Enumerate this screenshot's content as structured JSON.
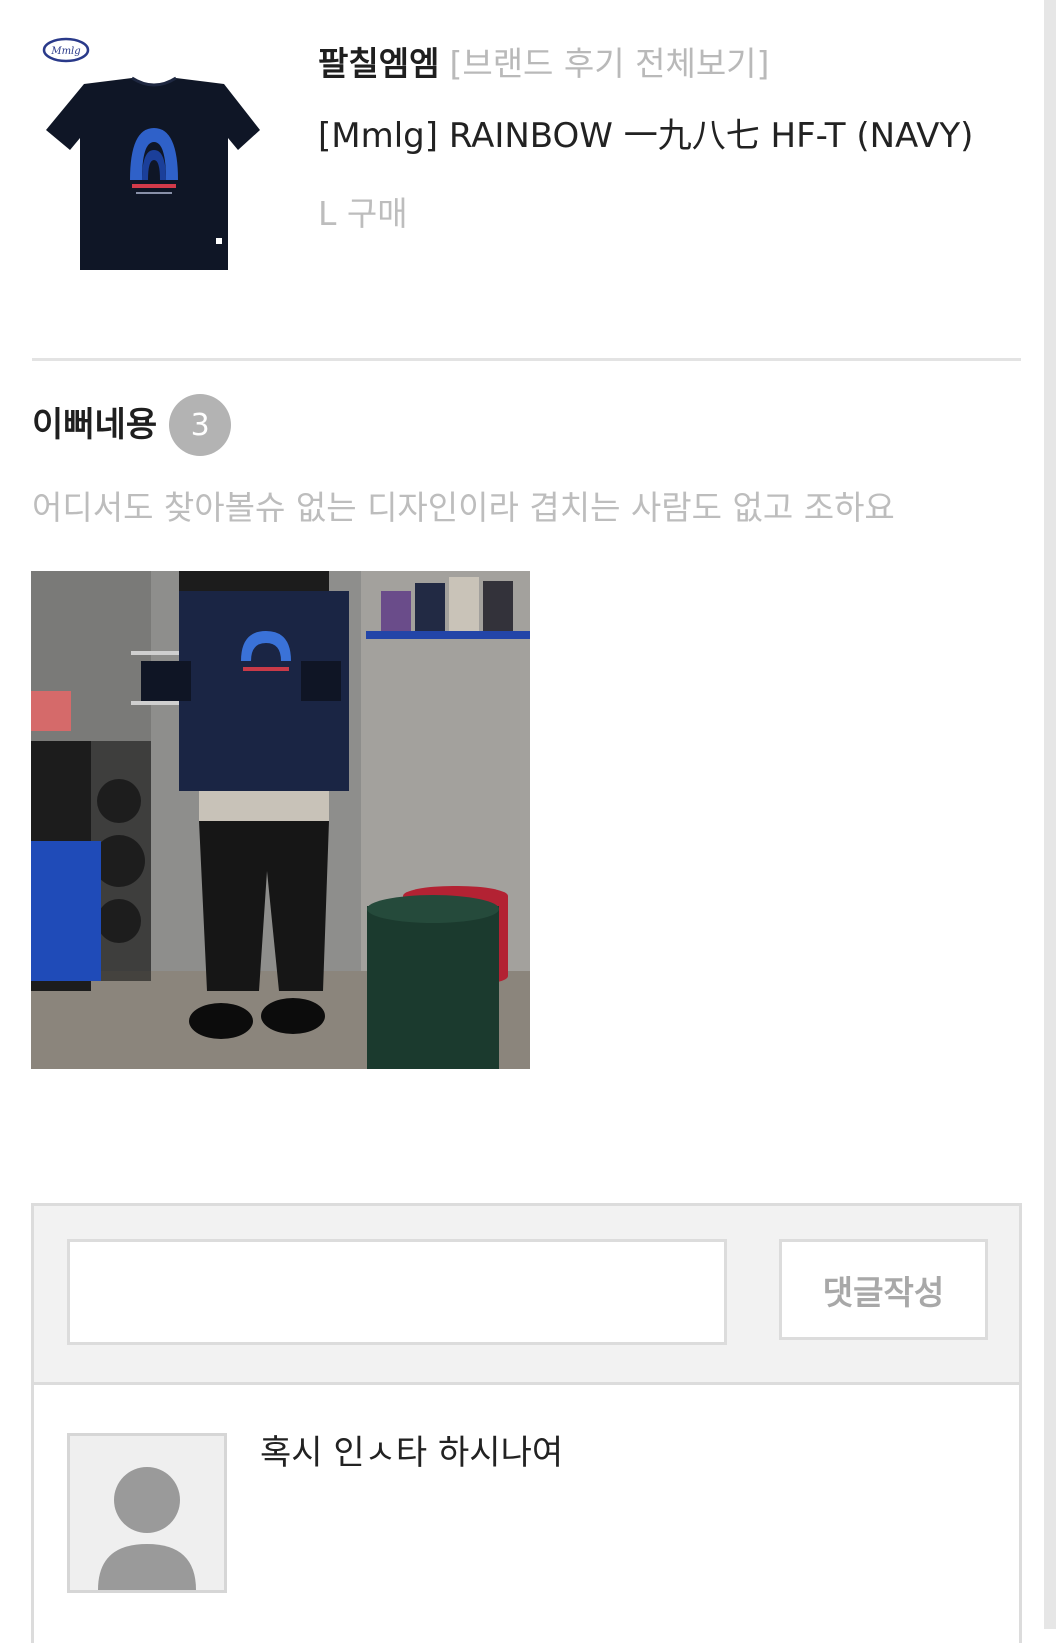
{
  "product": {
    "thumbnail_icon": "navy-tshirt-image",
    "brand_name": "팔칠엠엠",
    "brand_reviews_link": "[브랜드 후기 전체보기]",
    "name": "[Mmlg] RAINBOW 一九八七 HF-T (NAVY)",
    "purchase_option": "L 구매"
  },
  "review": {
    "title": "이뻐네용",
    "like_count": "3",
    "body": "어디서도 찾아볼슈 없는 디자인이라 겹치는 사람도 없고 조하요",
    "photo_icon": "review-photo-image"
  },
  "comments": {
    "input_value": "",
    "submit_label": "댓글작성",
    "items": [
      {
        "avatar_icon": "default-avatar-icon",
        "text": "혹시 인ㅅ타 하시나여"
      }
    ]
  },
  "colors": {
    "muted_text": "#bdbdbd",
    "badge": "#b3b3b3",
    "border": "#dcdcdc",
    "form_bg": "#f2f2f2"
  }
}
